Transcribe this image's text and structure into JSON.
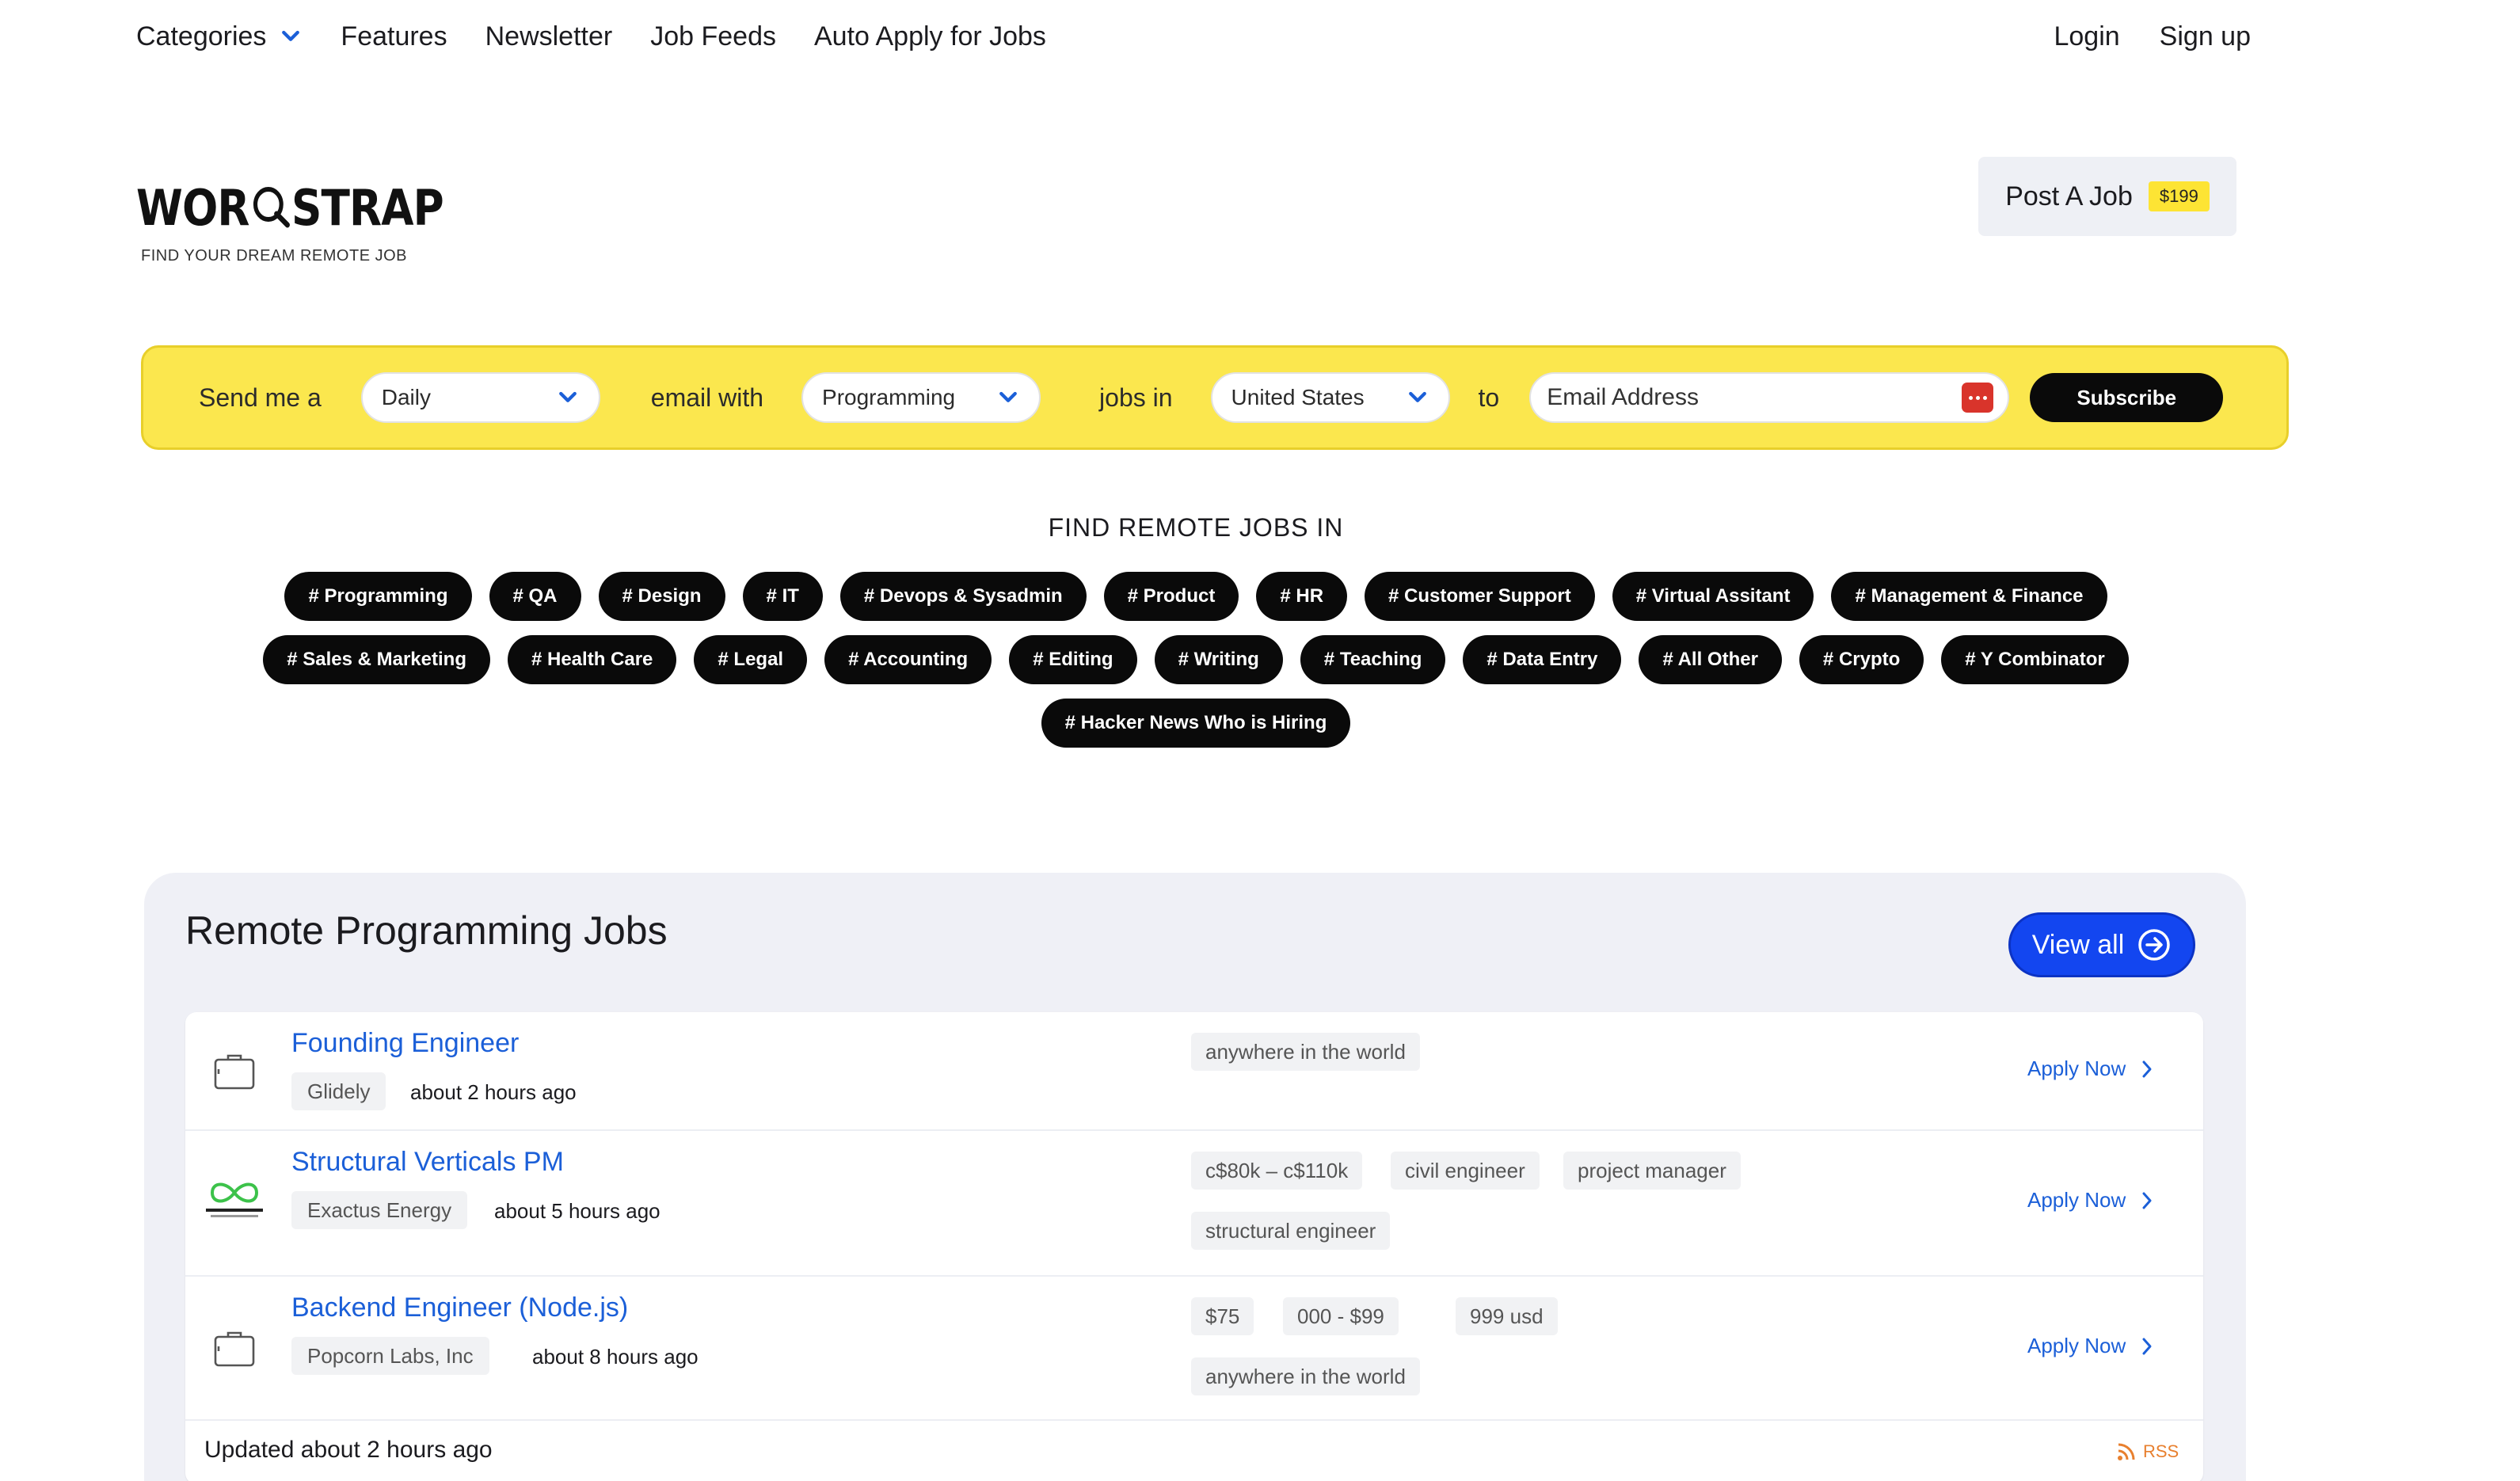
{
  "nav": {
    "categories": "Categories",
    "features": "Features",
    "newsletter": "Newsletter",
    "job_feeds": "Job Feeds",
    "auto_apply": "Auto Apply for Jobs",
    "login": "Login",
    "signup": "Sign up"
  },
  "brand": {
    "logo_left": "WOR",
    "logo_right": "STRAP",
    "tagline": "FIND YOUR DREAM REMOTE JOB"
  },
  "post_job": {
    "label": "Post A Job",
    "price": "$199"
  },
  "subscribe": {
    "text_send": "Send me a",
    "frequency": "Daily",
    "text_email_with": "email with",
    "category": "Programming",
    "text_jobs_in": "jobs in",
    "country": "United States",
    "text_to": "to",
    "email_placeholder": "Email Address",
    "button": "Subscribe"
  },
  "find": {
    "title": "FIND REMOTE JOBS IN",
    "rows": [
      [
        "# Programming",
        "# QA",
        "# Design",
        "# IT",
        "# Devops & Sysadmin",
        "# Product",
        "# HR",
        "# Customer Support",
        "# Virtual Assitant",
        "# Management & Finance"
      ],
      [
        "# Sales & Marketing",
        "# Health Care",
        "# Legal",
        "# Accounting",
        "# Editing",
        "# Writing",
        "# Teaching",
        "# Data Entry",
        "# All Other",
        "# Crypto",
        "# Y Combinator"
      ],
      [
        "# Hacker News Who is Hiring"
      ]
    ]
  },
  "jobs": {
    "title": "Remote Programming Jobs",
    "view_all": "View all",
    "apply_label": "Apply Now",
    "items": [
      {
        "title": "Founding Engineer",
        "company": "Glidely",
        "posted": "about 2 hours ago",
        "tags": [
          "anywhere in the world"
        ]
      },
      {
        "title": "Structural Verticals PM",
        "company": "Exactus Energy",
        "posted": "about 5 hours ago",
        "tags": [
          "c$80k – c$110k",
          "civil engineer",
          "project manager",
          "structural engineer"
        ]
      },
      {
        "title": "Backend Engineer (Node.js)",
        "company": "Popcorn Labs, Inc",
        "posted": "about 8 hours ago",
        "tags": [
          "$75",
          "000 - $99",
          "999 usd",
          "anywhere in the world"
        ]
      }
    ],
    "updated": "Updated about 2 hours ago",
    "rss": "RSS"
  },
  "colors": {
    "accent_yellow": "#fbe74e",
    "primary_blue": "#1346f0",
    "link_blue": "#1b5fd8",
    "tag_black": "#0a0a0a",
    "panel_bg": "#eff0f6",
    "rss_orange": "#e8802f"
  }
}
